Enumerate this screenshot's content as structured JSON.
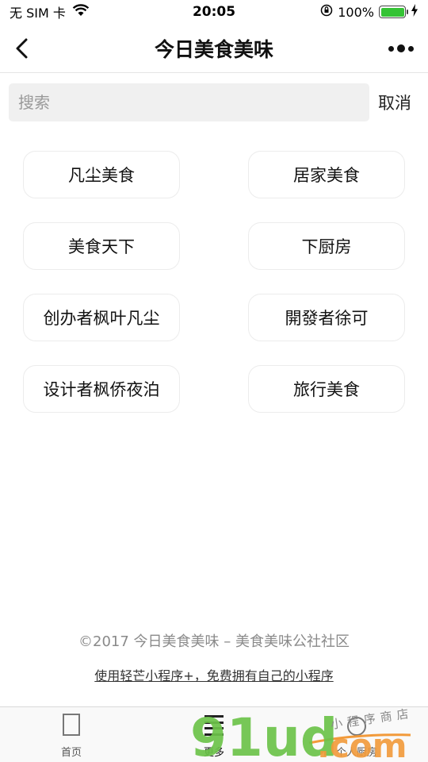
{
  "status_bar": {
    "carrier": "无 SIM 卡",
    "time": "20:05",
    "battery_text": "100%",
    "battery_level": 1.0,
    "battery_color": "#35c335"
  },
  "nav": {
    "title": "今日美食美味",
    "back_icon": "chevron-left-icon",
    "more_icon": "more-dots-icon"
  },
  "search": {
    "placeholder": "搜索",
    "cancel_label": "取消"
  },
  "tags": [
    "凡尘美食",
    "居家美食",
    "美食天下",
    "下厨房",
    "创办者枫叶凡尘",
    "開發者徐可",
    "设计者枫侨夜泊",
    "旅行美食"
  ],
  "footer": {
    "copyright": "©2017 今日美食美味 – 美食美味公社社区",
    "link": "使用轻芒小程序+，免费拥有自己的小程序"
  },
  "tab_bar": {
    "items": [
      {
        "label": "首页",
        "icon": "page-icon"
      },
      {
        "label": "更多",
        "icon": "list-icon"
      },
      {
        "label": "个人厨房",
        "icon": "user-icon"
      }
    ]
  },
  "watermark": {
    "main": "91ud",
    "suffix": ".com",
    "tagline": "小程序商店",
    "green": "#6cc34a",
    "orange": "#f29a3a"
  }
}
